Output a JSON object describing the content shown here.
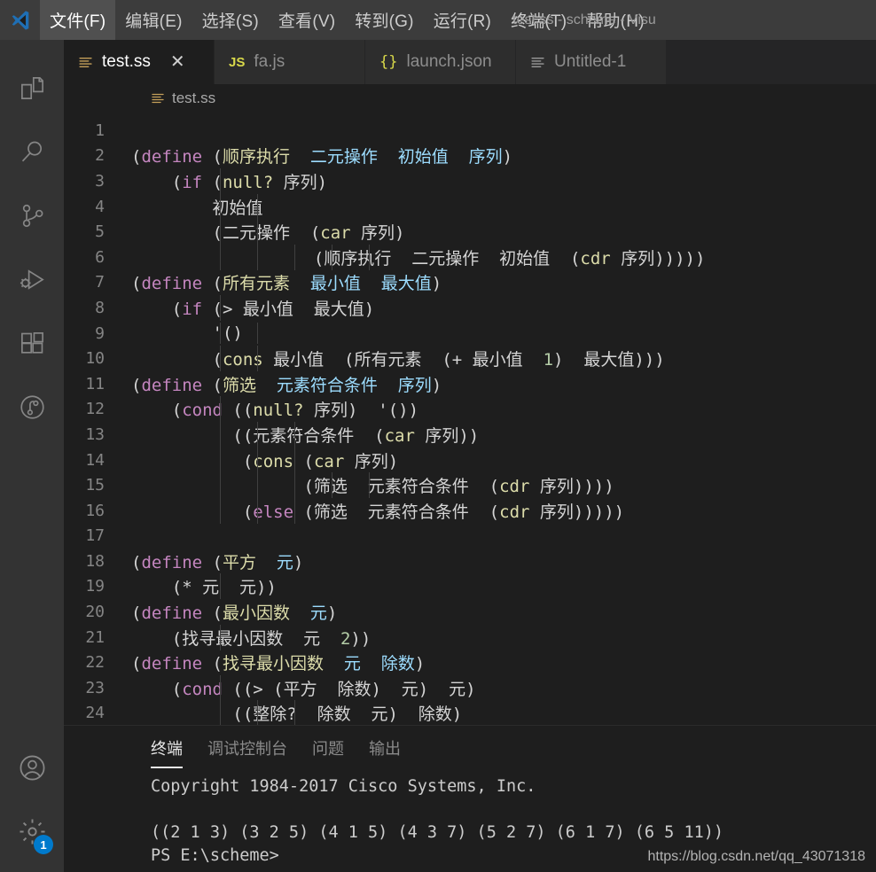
{
  "titlebar": {
    "logo_icon": "vscode-logo-icon",
    "window_title": "test.ss - scheme - Visu",
    "menus": [
      {
        "label": "文件(F)",
        "active": true
      },
      {
        "label": "编辑(E)",
        "active": false
      },
      {
        "label": "选择(S)",
        "active": false
      },
      {
        "label": "查看(V)",
        "active": false
      },
      {
        "label": "转到(G)",
        "active": false
      },
      {
        "label": "运行(R)",
        "active": false
      },
      {
        "label": "终端(T)",
        "active": false
      },
      {
        "label": "帮助(H)",
        "active": false
      }
    ]
  },
  "activitybar": {
    "items": [
      {
        "name": "explorer-icon",
        "title": "资源管理器"
      },
      {
        "name": "search-icon",
        "title": "搜索"
      },
      {
        "name": "source-control-icon",
        "title": "源代码管理"
      },
      {
        "name": "run-debug-icon",
        "title": "运行和调试"
      },
      {
        "name": "extensions-icon",
        "title": "扩展"
      },
      {
        "name": "gitlens-icon",
        "title": "GitLens"
      }
    ],
    "bottom": [
      {
        "name": "account-icon",
        "badge": ""
      },
      {
        "name": "gear-icon",
        "badge": "1"
      }
    ]
  },
  "tabs": [
    {
      "label": "test.ss",
      "icon": "scheme-file-icon",
      "active": true,
      "close": "✕"
    },
    {
      "label": "fa.js",
      "icon": "js-file-icon",
      "active": false,
      "close": ""
    },
    {
      "label": "launch.json",
      "icon": "json-file-icon",
      "active": false,
      "close": ""
    },
    {
      "label": "Untitled-1",
      "icon": "plain-file-icon",
      "active": false,
      "close": ""
    }
  ],
  "breadcrumb": {
    "icon": "scheme-file-icon",
    "label": "test.ss"
  },
  "editor": {
    "lines": [
      {
        "n": "1",
        "guides": [],
        "tokens": []
      },
      {
        "n": "2",
        "guides": [],
        "tokens": [
          {
            "t": "(",
            "c": "pn"
          },
          {
            "t": "define",
            "c": "kw"
          },
          {
            "t": " (",
            "c": "pn"
          },
          {
            "t": "顺序执行",
            "c": "fn"
          },
          {
            "t": "  ",
            "c": "pn"
          },
          {
            "t": "二元操作  初始值  序列",
            "c": "par"
          },
          {
            "t": ")",
            "c": "pn"
          }
        ]
      },
      {
        "n": "3",
        "guides": [
          118
        ],
        "tokens": [
          {
            "t": "    (",
            "c": "pn"
          },
          {
            "t": "if",
            "c": "kw"
          },
          {
            "t": " (",
            "c": "pn"
          },
          {
            "t": "null?",
            "c": "fn"
          },
          {
            "t": " 序列)",
            "c": "pn"
          }
        ]
      },
      {
        "n": "4",
        "guides": [
          118,
          160
        ],
        "tokens": [
          {
            "t": "        初始值",
            "c": "pn"
          }
        ]
      },
      {
        "n": "5",
        "guides": [
          118,
          160
        ],
        "tokens": [
          {
            "t": "        (二元操作  (",
            "c": "pn"
          },
          {
            "t": "car",
            "c": "fn"
          },
          {
            "t": " 序列)",
            "c": "pn"
          }
        ]
      },
      {
        "n": "6",
        "guides": [
          118,
          160,
          202,
          244,
          286
        ],
        "tokens": [
          {
            "t": "                  (顺序执行  二元操作  初始值  (",
            "c": "pn"
          },
          {
            "t": "cdr",
            "c": "fn"
          },
          {
            "t": " 序列)))))",
            "c": "pn"
          }
        ]
      },
      {
        "n": "7",
        "guides": [],
        "tokens": [
          {
            "t": "(",
            "c": "pn"
          },
          {
            "t": "define",
            "c": "kw"
          },
          {
            "t": " (",
            "c": "pn"
          },
          {
            "t": "所有元素",
            "c": "fn"
          },
          {
            "t": "  ",
            "c": "pn"
          },
          {
            "t": "最小值  最大值",
            "c": "par"
          },
          {
            "t": ")",
            "c": "pn"
          }
        ]
      },
      {
        "n": "8",
        "guides": [
          118
        ],
        "tokens": [
          {
            "t": "    (",
            "c": "pn"
          },
          {
            "t": "if",
            "c": "kw"
          },
          {
            "t": " (> 最小值  最大值)",
            "c": "pn"
          }
        ]
      },
      {
        "n": "9",
        "guides": [
          118,
          160
        ],
        "tokens": [
          {
            "t": "        '()",
            "c": "pn"
          }
        ]
      },
      {
        "n": "10",
        "guides": [
          118,
          160
        ],
        "tokens": [
          {
            "t": "        (",
            "c": "pn"
          },
          {
            "t": "cons",
            "c": "fn"
          },
          {
            "t": " 最小值  (所有元素  (+ 最小值  ",
            "c": "pn"
          },
          {
            "t": "1",
            "c": "num"
          },
          {
            "t": ")  最大值)))",
            "c": "pn"
          }
        ]
      },
      {
        "n": "11",
        "guides": [],
        "tokens": [
          {
            "t": "(",
            "c": "pn"
          },
          {
            "t": "define",
            "c": "kw"
          },
          {
            "t": " (",
            "c": "pn"
          },
          {
            "t": "筛选",
            "c": "fn"
          },
          {
            "t": "  ",
            "c": "pn"
          },
          {
            "t": "元素符合条件  序列",
            "c": "par"
          },
          {
            "t": ")",
            "c": "pn"
          }
        ]
      },
      {
        "n": "12",
        "guides": [
          118
        ],
        "tokens": [
          {
            "t": "    (",
            "c": "pn"
          },
          {
            "t": "cond",
            "c": "kw"
          },
          {
            "t": " ((",
            "c": "pn"
          },
          {
            "t": "null?",
            "c": "fn"
          },
          {
            "t": " 序列)  '())",
            "c": "pn"
          }
        ]
      },
      {
        "n": "13",
        "guides": [
          118,
          160,
          202
        ],
        "tokens": [
          {
            "t": "          ((元素符合条件  (",
            "c": "pn"
          },
          {
            "t": "car",
            "c": "fn"
          },
          {
            "t": " 序列))",
            "c": "pn"
          }
        ]
      },
      {
        "n": "14",
        "guides": [
          118,
          160,
          202
        ],
        "tokens": [
          {
            "t": "           (",
            "c": "pn"
          },
          {
            "t": "cons",
            "c": "fn"
          },
          {
            "t": " (",
            "c": "pn"
          },
          {
            "t": "car",
            "c": "fn"
          },
          {
            "t": " 序列)",
            "c": "pn"
          }
        ]
      },
      {
        "n": "15",
        "guides": [
          118,
          160,
          202,
          244,
          286
        ],
        "tokens": [
          {
            "t": "                 (筛选  元素符合条件  (",
            "c": "pn"
          },
          {
            "t": "cdr",
            "c": "fn"
          },
          {
            "t": " 序列))))",
            "c": "pn"
          }
        ]
      },
      {
        "n": "16",
        "guides": [
          118,
          160,
          202
        ],
        "tokens": [
          {
            "t": "           (",
            "c": "pn"
          },
          {
            "t": "else",
            "c": "kw"
          },
          {
            "t": " (筛选  元素符合条件  (",
            "c": "pn"
          },
          {
            "t": "cdr",
            "c": "fn"
          },
          {
            "t": " 序列)))))",
            "c": "pn"
          }
        ]
      },
      {
        "n": "17",
        "guides": [],
        "tokens": []
      },
      {
        "n": "18",
        "guides": [],
        "tokens": [
          {
            "t": "(",
            "c": "pn"
          },
          {
            "t": "define",
            "c": "kw"
          },
          {
            "t": " (",
            "c": "pn"
          },
          {
            "t": "平方",
            "c": "fn"
          },
          {
            "t": "  ",
            "c": "pn"
          },
          {
            "t": "元",
            "c": "par"
          },
          {
            "t": ")",
            "c": "pn"
          }
        ]
      },
      {
        "n": "19",
        "guides": [
          118
        ],
        "tokens": [
          {
            "t": "    (* 元  元))",
            "c": "pn"
          }
        ]
      },
      {
        "n": "20",
        "guides": [],
        "tokens": [
          {
            "t": "(",
            "c": "pn"
          },
          {
            "t": "define",
            "c": "kw"
          },
          {
            "t": " (",
            "c": "pn"
          },
          {
            "t": "最小因数",
            "c": "fn"
          },
          {
            "t": "  ",
            "c": "pn"
          },
          {
            "t": "元",
            "c": "par"
          },
          {
            "t": ")",
            "c": "pn"
          }
        ]
      },
      {
        "n": "21",
        "guides": [
          118
        ],
        "tokens": [
          {
            "t": "    (找寻最小因数  元  ",
            "c": "pn"
          },
          {
            "t": "2",
            "c": "num"
          },
          {
            "t": "))",
            "c": "pn"
          }
        ]
      },
      {
        "n": "22",
        "guides": [],
        "tokens": [
          {
            "t": "(",
            "c": "pn"
          },
          {
            "t": "define",
            "c": "kw"
          },
          {
            "t": " (",
            "c": "pn"
          },
          {
            "t": "找寻最小因数",
            "c": "fn"
          },
          {
            "t": "  ",
            "c": "pn"
          },
          {
            "t": "元  除数",
            "c": "par"
          },
          {
            "t": ")",
            "c": "pn"
          }
        ]
      },
      {
        "n": "23",
        "guides": [
          118
        ],
        "tokens": [
          {
            "t": "    (",
            "c": "pn"
          },
          {
            "t": "cond",
            "c": "kw"
          },
          {
            "t": " ((> (平方  除数)  元)  元)",
            "c": "pn"
          }
        ]
      },
      {
        "n": "24",
        "guides": [
          118,
          160,
          202
        ],
        "tokens": [
          {
            "t": "          ((整除?  除数  元)  除数)",
            "c": "pn"
          }
        ]
      }
    ]
  },
  "panel": {
    "tabs": [
      {
        "label": "终端",
        "active": true
      },
      {
        "label": "调试控制台",
        "active": false
      },
      {
        "label": "问题",
        "active": false
      },
      {
        "label": "输出",
        "active": false
      }
    ],
    "terminal_text": "Copyright 1984-2017 Cisco Systems, Inc.\n\n((2 1 3) (3 2 5) (4 1 5) (4 3 7) (5 2 7) (6 1 7) (6 5 11))\nPS E:\\scheme>"
  },
  "watermark": "https://blog.csdn.net/qq_43071318",
  "colors": {
    "accent": "#007acc",
    "titlebar_bg": "#3c3c3c",
    "activitybar_bg": "#333333",
    "editor_bg": "#1e1e1e",
    "tabbar_bg": "#252526",
    "keyword": "#c586c0",
    "function": "#dcdcaa",
    "parameter": "#9cdcfe",
    "number": "#b5cea8",
    "plain": "#d4d4d4"
  }
}
